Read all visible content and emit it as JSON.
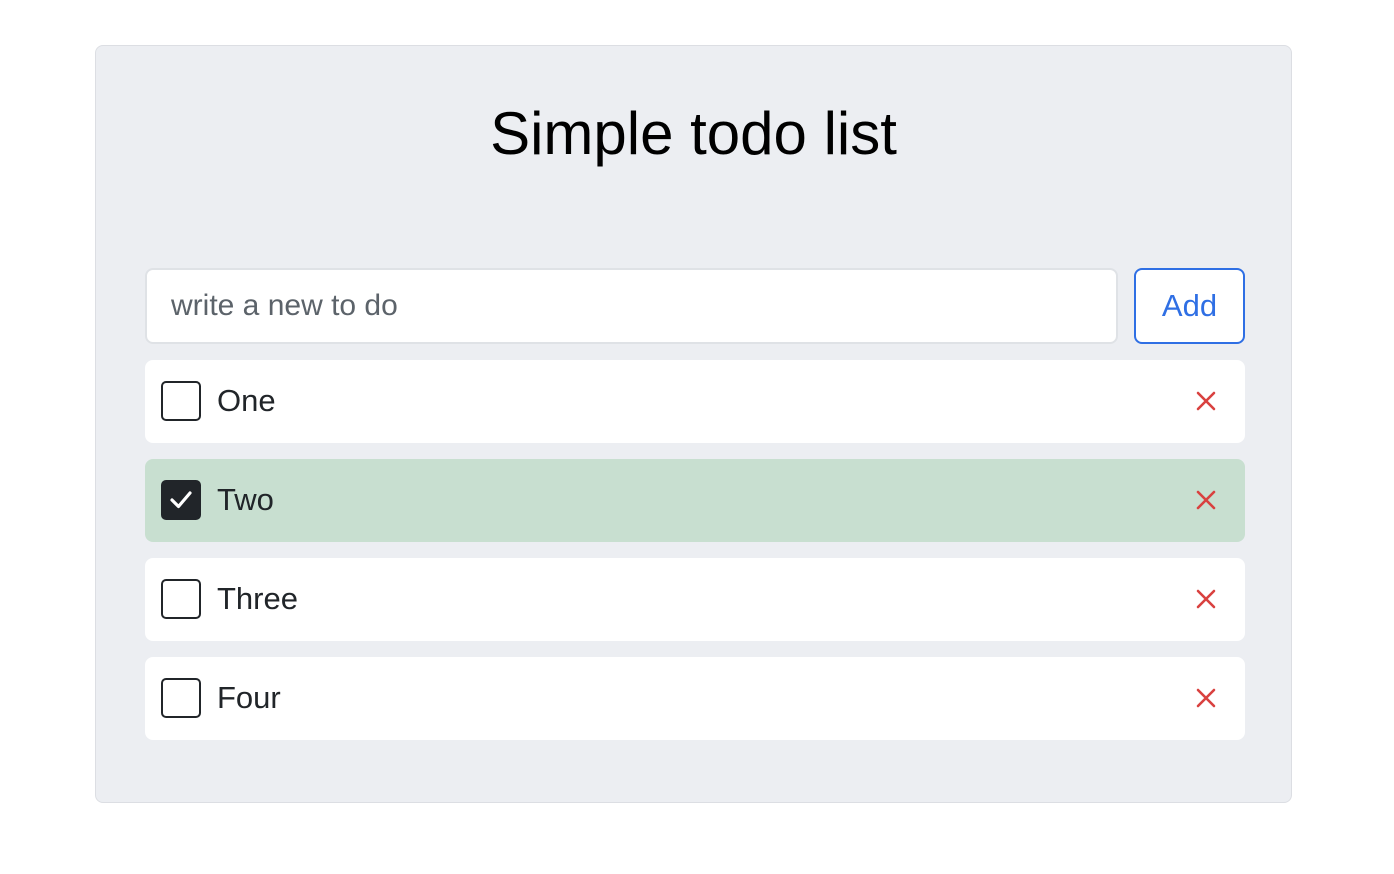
{
  "title": "Simple todo list",
  "input": {
    "placeholder": "write a new to do",
    "value": ""
  },
  "add_button": {
    "label": "Add"
  },
  "colors": {
    "accent": "#2f6fe4",
    "delete": "#d9413f",
    "done_background": "#c8dfd0",
    "card_background": "#eceef2"
  },
  "todos": [
    {
      "label": "One",
      "checked": false
    },
    {
      "label": "Two",
      "checked": true
    },
    {
      "label": "Three",
      "checked": false
    },
    {
      "label": "Four",
      "checked": false
    }
  ],
  "icons": {
    "checkbox_checked": "checkmark-icon",
    "delete": "close-icon"
  }
}
